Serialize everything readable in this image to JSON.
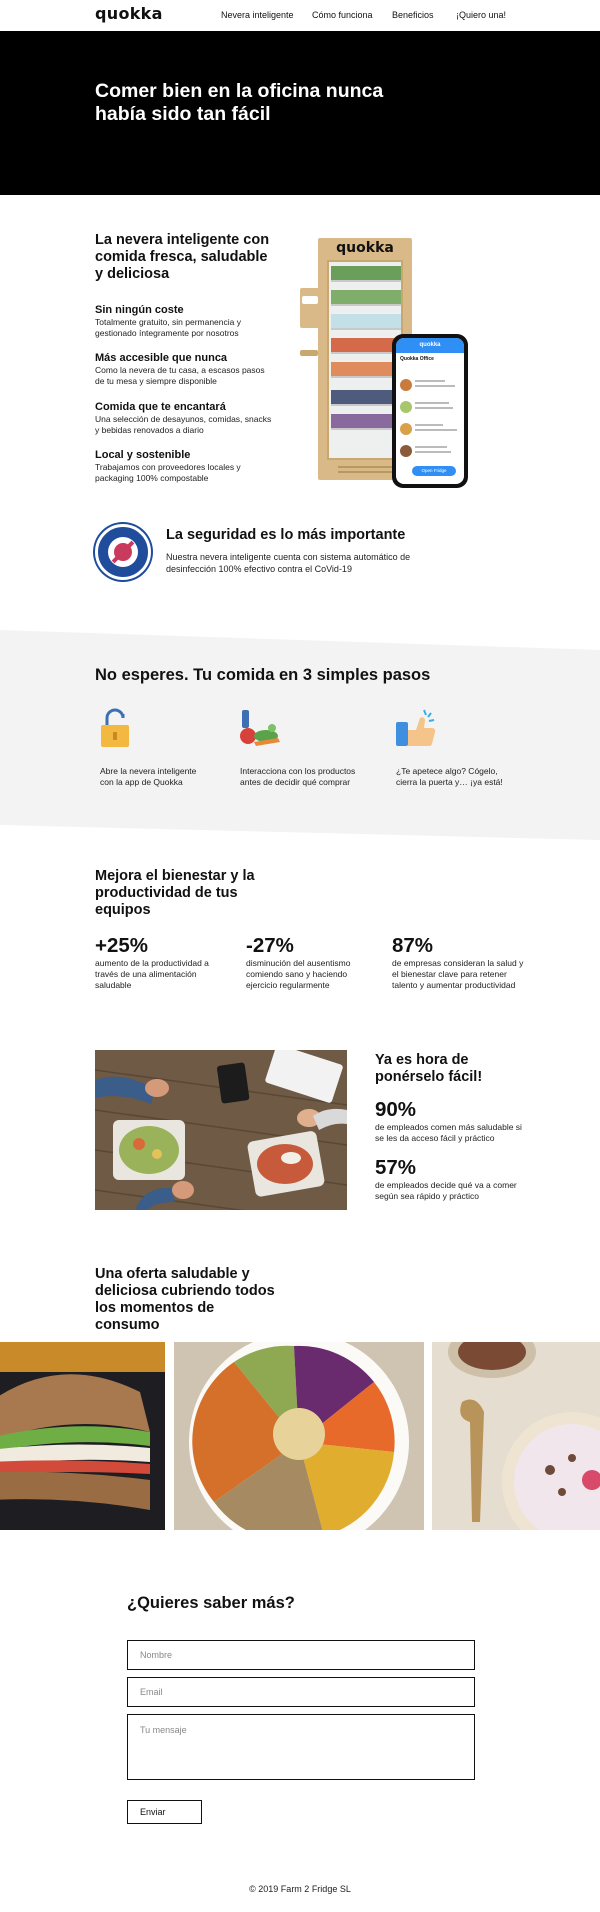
{
  "header": {
    "logo": "quokka",
    "nav": [
      "Nevera inteligente",
      "Cómo funciona",
      "Beneficios",
      "¡Quiero una!"
    ]
  },
  "hero": {
    "title": "Comer bien en la oficina nunca había sido tan fácil"
  },
  "features": {
    "title": "La nevera inteligente con comida fresca, saludable y deliciosa",
    "items": [
      {
        "title": "Sin ningún coste",
        "text": "Totalmente gratuito, sin permanencia y gestionado íntegramente por nosotros"
      },
      {
        "title": "Más accesible que nunca",
        "text": "Como la nevera de tu casa, a escasos pasos de tu mesa y siempre disponible"
      },
      {
        "title": "Comida que te encantará",
        "text": "Una selección de desayunos, comidas, snacks y bebidas renovados a diario"
      },
      {
        "title": "Local y sostenible",
        "text": "Trabajamos con proveedores locales y packaging 100% compostable"
      }
    ],
    "fridge_brand": "quokka",
    "phone": {
      "bar": "quokka",
      "office": "Quokka Office",
      "button": "Open Fridge"
    }
  },
  "safety": {
    "title": "La seguridad es lo más importante",
    "text": "Nuestra nevera inteligente cuenta con sistema automático de desinfección 100% efectivo contra el CoVid-19",
    "badge_top": "CORONAVIRUS",
    "badge_bottom": "COVID-19"
  },
  "steps": {
    "title": "No esperes. Tu comida en 3 simples pasos",
    "items": [
      {
        "icon": "padlock-icon",
        "text": "Abre la nevera inteligente con la app de Quokka"
      },
      {
        "icon": "groceries-icon",
        "text": "Interacciona con los productos antes de decidir qué comprar"
      },
      {
        "icon": "phone-thumbs-up-icon",
        "text": "¿Te apetece algo? Cógelo, cierra la puerta y… ¡ya está!"
      }
    ]
  },
  "stats": {
    "title": "Mejora el bienestar y la productividad de tus equipos",
    "items": [
      {
        "value": "+25%",
        "text": "aumento de la productividad a través de una alimentación saludable"
      },
      {
        "value": "-27%",
        "text": "disminución del ausentismo comiendo sano y haciendo ejercicio regularmente"
      },
      {
        "value": "87%",
        "text": "de empresas consideran la salud y el bienestar clave para retener talento y aumentar productividad"
      }
    ]
  },
  "easy": {
    "title": "Ya es hora de ponérselo fácil!",
    "items": [
      {
        "value": "90%",
        "text": "de empleados comen más saludable si se les da acceso fácil y práctico"
      },
      {
        "value": "57%",
        "text": "de empleados decide qué va a comer según sea rápido y práctico"
      }
    ]
  },
  "offer": {
    "title": "Una oferta saludable y deliciosa cubriendo todos los momentos de consumo"
  },
  "form": {
    "title": "¿Quieres saber más?",
    "name_placeholder": "Nombre",
    "email_placeholder": "Email",
    "message_placeholder": "Tu mensaje",
    "submit": "Enviar"
  },
  "footer": {
    "text": "© 2019 Farm 2 Fridge SL"
  },
  "colors": {
    "hero_bg": "#000000",
    "steps_bg": "#f3f3f3",
    "accent_blue": "#2f8ff5"
  }
}
